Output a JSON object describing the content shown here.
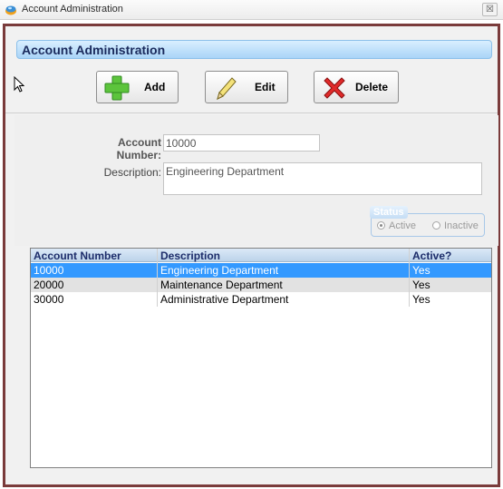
{
  "window": {
    "title": "Account Administration",
    "close_glyph": "☒"
  },
  "header": {
    "title": "Account Administration"
  },
  "toolbar": {
    "add_label": "Add",
    "edit_label": "Edit",
    "delete_label": "Delete",
    "add_icon": "plus-icon",
    "edit_icon": "pencil-icon",
    "delete_icon": "x-icon"
  },
  "form": {
    "account_number_label": "Account Number:",
    "account_number_value": "10000",
    "description_label": "Description:",
    "description_value": "Engineering Department",
    "status": {
      "legend": "Status",
      "options": [
        {
          "label": "Active",
          "selected": true
        },
        {
          "label": "Inactive",
          "selected": false
        }
      ]
    }
  },
  "grid": {
    "columns": [
      "Account Number",
      "Description",
      "Active?"
    ],
    "rows": [
      {
        "account_number": "10000",
        "description": "Engineering Department",
        "active": "Yes",
        "selected": true
      },
      {
        "account_number": "20000",
        "description": "Maintenance Department",
        "active": "Yes",
        "selected": false
      },
      {
        "account_number": "30000",
        "description": "Administrative Department",
        "active": "Yes",
        "selected": false
      }
    ]
  },
  "colors": {
    "frame_border": "#7a3b3b",
    "header_text": "#1a2a5c",
    "selection": "#3399ff"
  }
}
